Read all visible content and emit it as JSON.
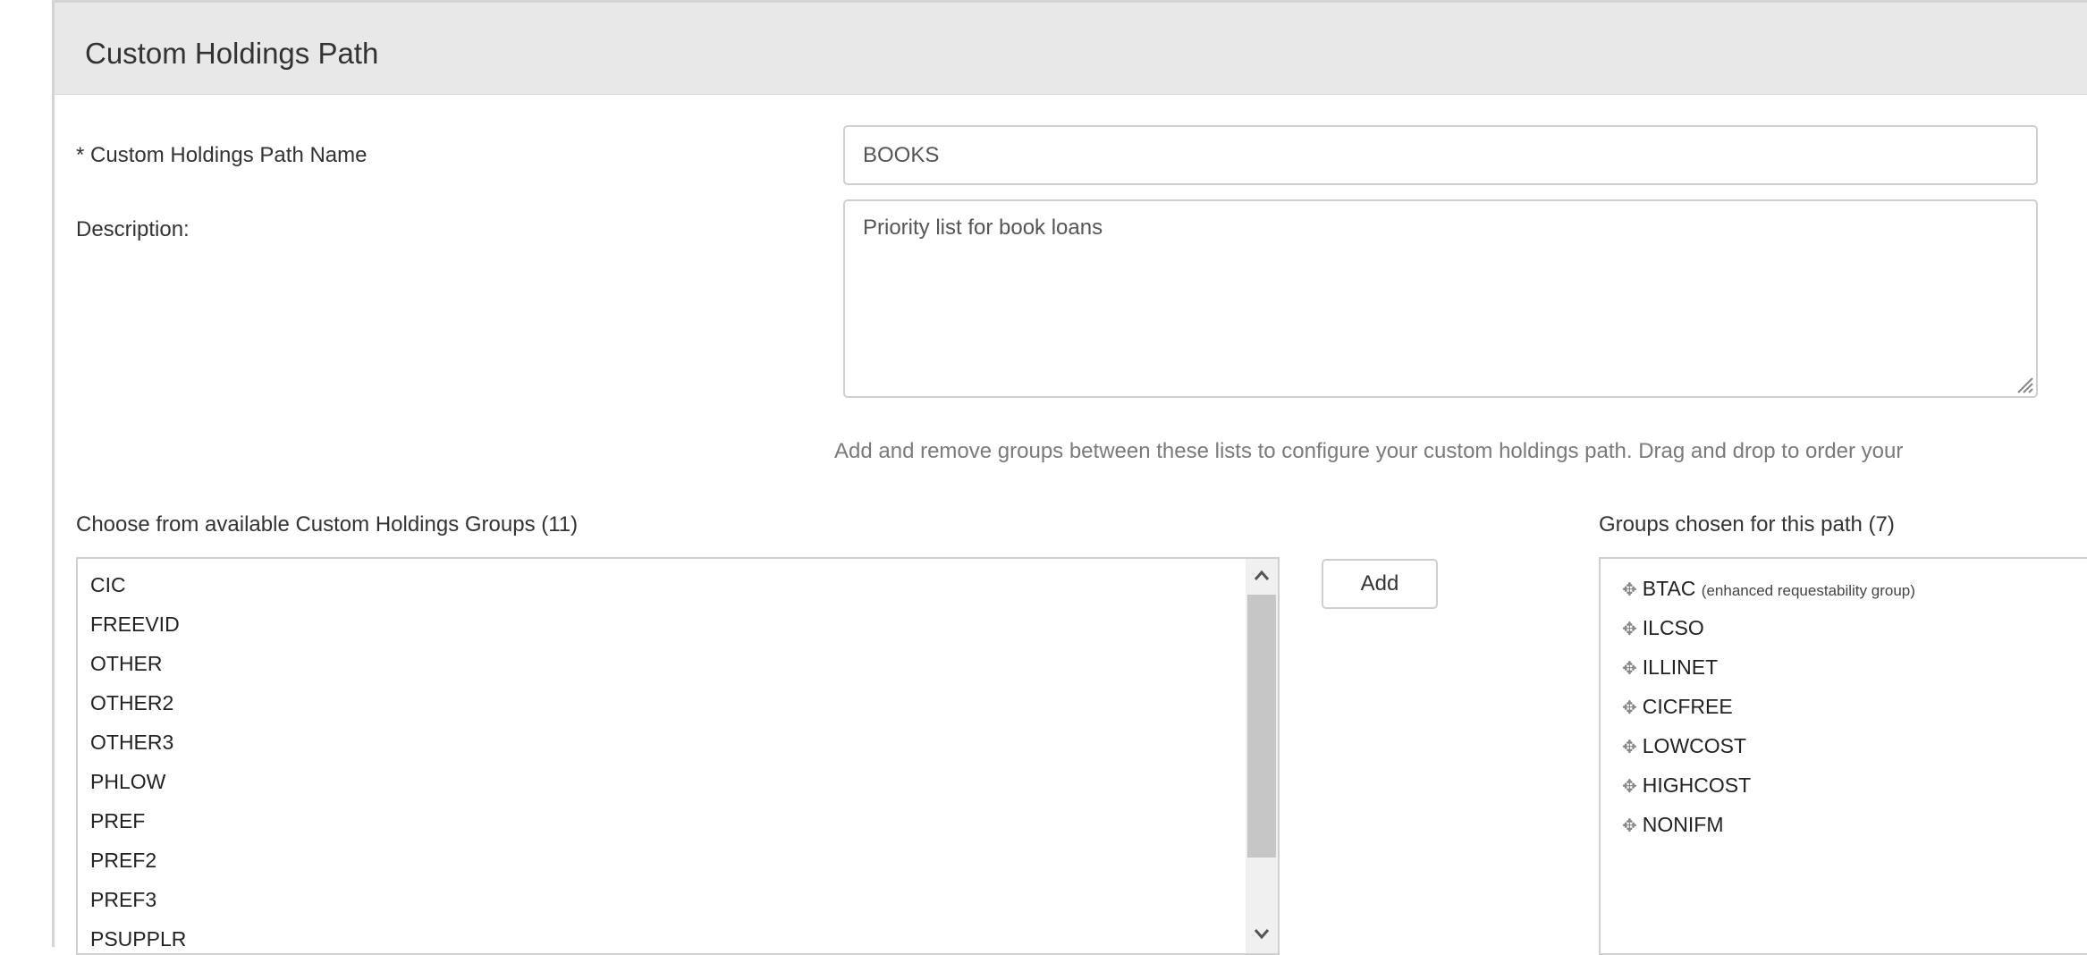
{
  "header": {
    "title": "Custom Holdings Path"
  },
  "form": {
    "name_label": "* Custom Holdings Path Name",
    "name_value": "BOOKS",
    "description_label": "Description:",
    "description_value": "Priority list for book loans",
    "help_text": "Add and remove groups between these lists to configure your custom holdings path. Drag and drop to order your"
  },
  "available": {
    "label": "Choose from available Custom Holdings Groups (11)",
    "items": [
      "CIC",
      "FREEVID",
      "OTHER",
      "OTHER2",
      "OTHER3",
      "PHLOW",
      "PREF",
      "PREF2",
      "PREF3",
      "PSUPPLR"
    ]
  },
  "add_button": {
    "label": "Add"
  },
  "chosen": {
    "label": "Groups chosen for this path (7)",
    "items": [
      {
        "name": "BTAC",
        "note": "(enhanced requestability group)"
      },
      {
        "name": "ILCSO",
        "note": ""
      },
      {
        "name": "ILLINET",
        "note": ""
      },
      {
        "name": "CICFREE",
        "note": ""
      },
      {
        "name": "LOWCOST",
        "note": ""
      },
      {
        "name": "HIGHCOST",
        "note": ""
      },
      {
        "name": "NONIFM",
        "note": ""
      }
    ]
  },
  "icons": {
    "move": "move-icon",
    "scroll_up": "chevron-up-icon",
    "scroll_down": "chevron-down-icon",
    "resize": "resize-grip-icon"
  }
}
